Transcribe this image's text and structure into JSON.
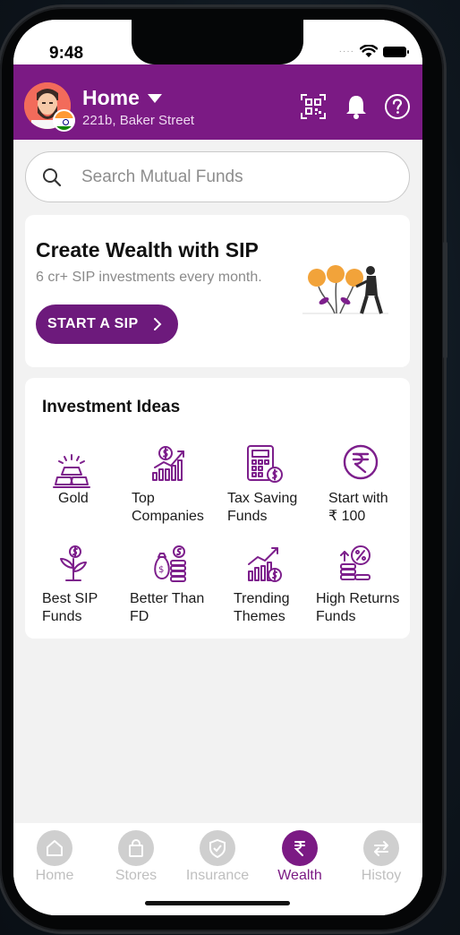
{
  "status_bar": {
    "time": "9:48"
  },
  "header": {
    "location_title": "Home",
    "location_subtitle": "221b, Baker Street"
  },
  "search": {
    "placeholder": "Search Mutual Funds"
  },
  "sip_card": {
    "title": "Create Wealth with SIP",
    "subtitle": "6 cr+ SIP investments every month.",
    "button_label": "START A SIP"
  },
  "investment_ideas": {
    "title": "Investment Ideas",
    "items": [
      {
        "line1": "Gold",
        "line2": "",
        "icon": "gold-bars-icon"
      },
      {
        "line1": "Top",
        "line2": "Companies",
        "icon": "growth-chart-icon"
      },
      {
        "line1": "Tax Saving",
        "line2": "Funds",
        "icon": "calculator-icon"
      },
      {
        "line1": "Start with",
        "line2": "₹ 100",
        "icon": "rupee-circle-icon"
      },
      {
        "line1": "Best SIP",
        "line2": "Funds",
        "icon": "money-plant-icon"
      },
      {
        "line1": "Better Than",
        "line2": "FD",
        "icon": "money-bag-icon"
      },
      {
        "line1": "Trending",
        "line2": "Themes",
        "icon": "trending-chart-icon"
      },
      {
        "line1": "High Returns",
        "line2": "Funds",
        "icon": "percent-coins-icon"
      }
    ]
  },
  "tabs": [
    {
      "label": "Home",
      "active": false
    },
    {
      "label": "Stores",
      "active": false
    },
    {
      "label": "Insurance",
      "active": false
    },
    {
      "label": "Wealth",
      "active": true
    },
    {
      "label": "Histoy",
      "active": false
    }
  ],
  "colors": {
    "brand_purple": "#7b1a84",
    "button_purple": "#6d1a7c",
    "icon_purple": "#7d1f8c",
    "inactive_tab": "#c2c2c2",
    "background": "#f2f2f2"
  }
}
